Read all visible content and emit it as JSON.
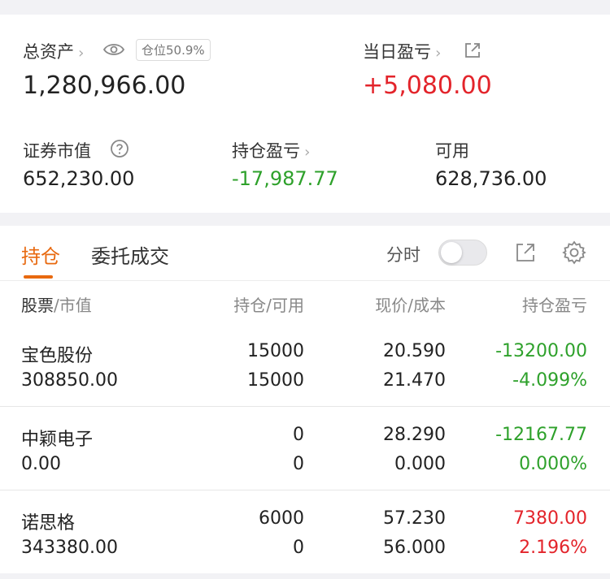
{
  "summary": {
    "total_assets_label": "总资产",
    "position_ratio": "仓位50.9%",
    "total_assets_value": "1,280,966.00",
    "daily_pnl_label": "当日盈亏",
    "daily_pnl_value": "+5,080.00",
    "market_value_label": "证券市值",
    "market_value": "652,230.00",
    "position_pnl_label": "持仓盈亏",
    "position_pnl_value": "-17,987.77",
    "available_label": "可用",
    "available_value": "628,736.00"
  },
  "tabs": {
    "holdings": "持仓",
    "orders": "委托成交",
    "intraday_label": "分时"
  },
  "table": {
    "headers": {
      "stock": "股票",
      "market_value": "/市值",
      "position": "持仓",
      "available": "/可用",
      "price": "现价",
      "cost": "/成本",
      "pnl": "持仓盈亏"
    },
    "rows": [
      {
        "name": "宝色股份",
        "market_value": "308850.00",
        "position": "15000",
        "available": "15000",
        "price": "20.590",
        "cost": "21.470",
        "pnl": "-13200.00",
        "pnl_pct": "-4.099%"
      },
      {
        "name": "中颖电子",
        "market_value": "0.00",
        "position": "0",
        "available": "0",
        "price": "28.290",
        "cost": "0.000",
        "pnl": "-12167.77",
        "pnl_pct": "0.000%"
      },
      {
        "name": "诺思格",
        "market_value": "343380.00",
        "position": "6000",
        "available": "0",
        "price": "57.230",
        "cost": "56.000",
        "pnl": "7380.00",
        "pnl_pct": "2.196%"
      }
    ]
  },
  "colors": {
    "gain": "#e3242b",
    "loss": "#2ea12b",
    "accent": "#e8690f"
  },
  "icons": [
    "chevron-right-icon",
    "eye-icon",
    "external-link-icon",
    "question-icon",
    "share-icon",
    "gear-icon"
  ]
}
